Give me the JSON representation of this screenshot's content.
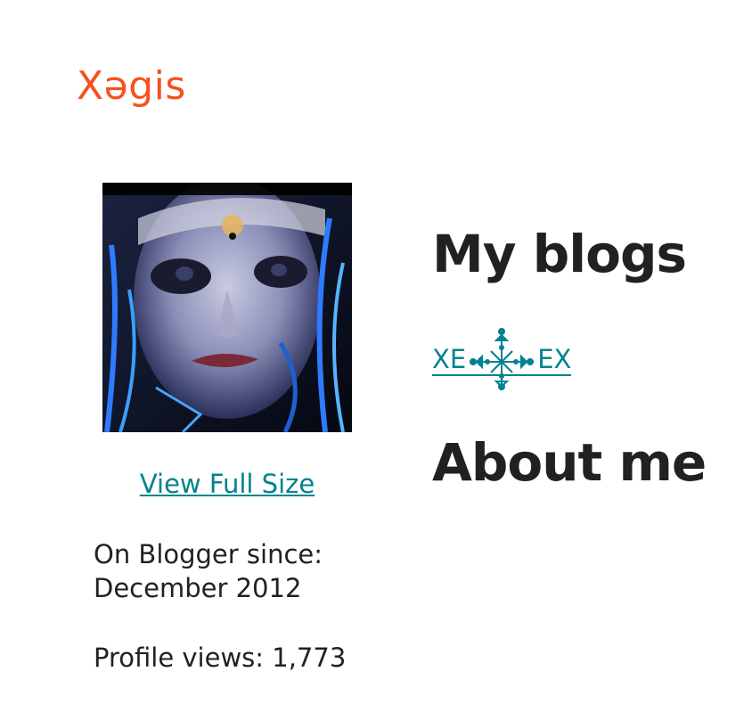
{
  "header": {
    "site_name": "Xəgis"
  },
  "profile": {
    "avatar_alt": "Profile photo",
    "view_full_size": "View Full Size",
    "since_label": "On Blogger since:",
    "since_value": "December 2012",
    "profile_views": "Profile views: 1,773"
  },
  "sections": {
    "my_blogs_title": "My blogs",
    "about_me_title": "About me"
  },
  "blogs": [
    {
      "prefix": "XE",
      "suffix": "EX",
      "ornament_icon": "snowflake-ornament-icon"
    }
  ],
  "colors": {
    "accent": "#f4511e",
    "link": "#00838f",
    "text": "#212121"
  }
}
